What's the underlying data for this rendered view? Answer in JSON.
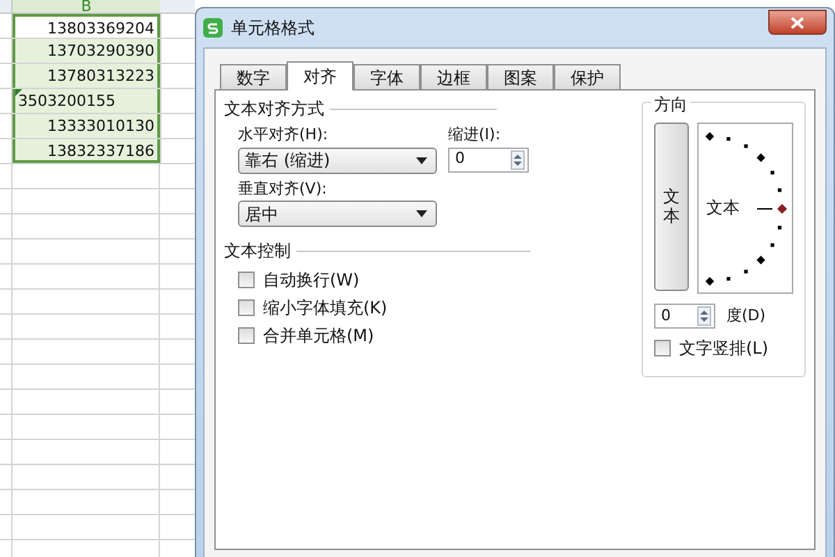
{
  "spreadsheet": {
    "column_header": "B",
    "cells": [
      {
        "value": "13803369204",
        "kind": "number",
        "active": true
      },
      {
        "value": "13703290390",
        "kind": "number",
        "active": false
      },
      {
        "value": "13780313223",
        "kind": "number",
        "active": false
      },
      {
        "value": "3503200155",
        "kind": "text",
        "active": false
      },
      {
        "value": "13333010130",
        "kind": "number",
        "active": false
      },
      {
        "value": "13832337186",
        "kind": "number",
        "active": false
      }
    ]
  },
  "dialog": {
    "title": "单元格格式",
    "tabs": [
      {
        "label": "数字",
        "selected": false
      },
      {
        "label": "对齐",
        "selected": true
      },
      {
        "label": "字体",
        "selected": false
      },
      {
        "label": "边框",
        "selected": false
      },
      {
        "label": "图案",
        "selected": false
      },
      {
        "label": "保护",
        "selected": false
      }
    ],
    "alignment": {
      "heading": "文本对齐方式",
      "horizontal": {
        "label": "水平对齐(H):",
        "value": "靠右 (缩进)"
      },
      "indent": {
        "label": "缩进(I):",
        "value": "0"
      },
      "vertical": {
        "label": "垂直对齐(V):",
        "value": "居中"
      }
    },
    "text_control": {
      "heading": "文本控制",
      "options": [
        {
          "label": "自动换行(W)",
          "checked": false
        },
        {
          "label": "缩小字体填充(K)",
          "checked": false
        },
        {
          "label": "合并单元格(M)",
          "checked": false
        }
      ]
    },
    "orientation": {
      "heading": "方向",
      "vertical_text_button": "文本",
      "dial_label": "文本",
      "degrees": {
        "value": "0",
        "label": "度(D)"
      },
      "vertical_stack": {
        "label": "文字竖排(L)",
        "checked": false
      }
    }
  }
}
